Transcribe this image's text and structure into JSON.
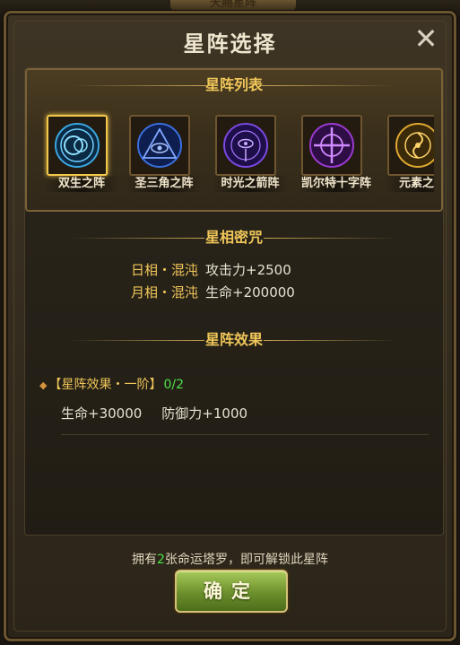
{
  "background": {
    "peek_title": "天赐星阵"
  },
  "dialog": {
    "title": "星阵选择",
    "close_glyph": "✕"
  },
  "star_list": {
    "header": "星阵列表",
    "items": [
      {
        "name": "双生之阵",
        "selected": true,
        "icon": "twin-circle-emblem",
        "color": "#3aa7e0"
      },
      {
        "name": "圣三角之阵",
        "selected": false,
        "icon": "eye-triangle-emblem",
        "color": "#3a6fe0"
      },
      {
        "name": "时光之箭阵",
        "selected": false,
        "icon": "time-arrow-emblem",
        "color": "#7a4ae0"
      },
      {
        "name": "凯尔特十字阵",
        "selected": false,
        "icon": "celtic-cross-emblem",
        "color": "#9a3ad0"
      },
      {
        "name": "元素之阵",
        "selected": false,
        "icon": "element-emblem",
        "color": "#e0a830"
      }
    ]
  },
  "star_spell": {
    "header": "星相密咒",
    "lines": [
      {
        "label": "日相・混沌",
        "value": "攻击力+2500"
      },
      {
        "label": "月相・混沌",
        "value": "生命+200000"
      }
    ]
  },
  "star_effect": {
    "header": "星阵效果",
    "tier_title": "【星阵效果・一阶】",
    "progress": "0/2",
    "stats": [
      "生命+30000",
      "防御力+1000"
    ]
  },
  "unlock_hint": {
    "prefix": "拥有",
    "count": "2",
    "suffix": "张命运塔罗，即可解锁此星阵"
  },
  "confirm_button": {
    "label": "确定"
  }
}
